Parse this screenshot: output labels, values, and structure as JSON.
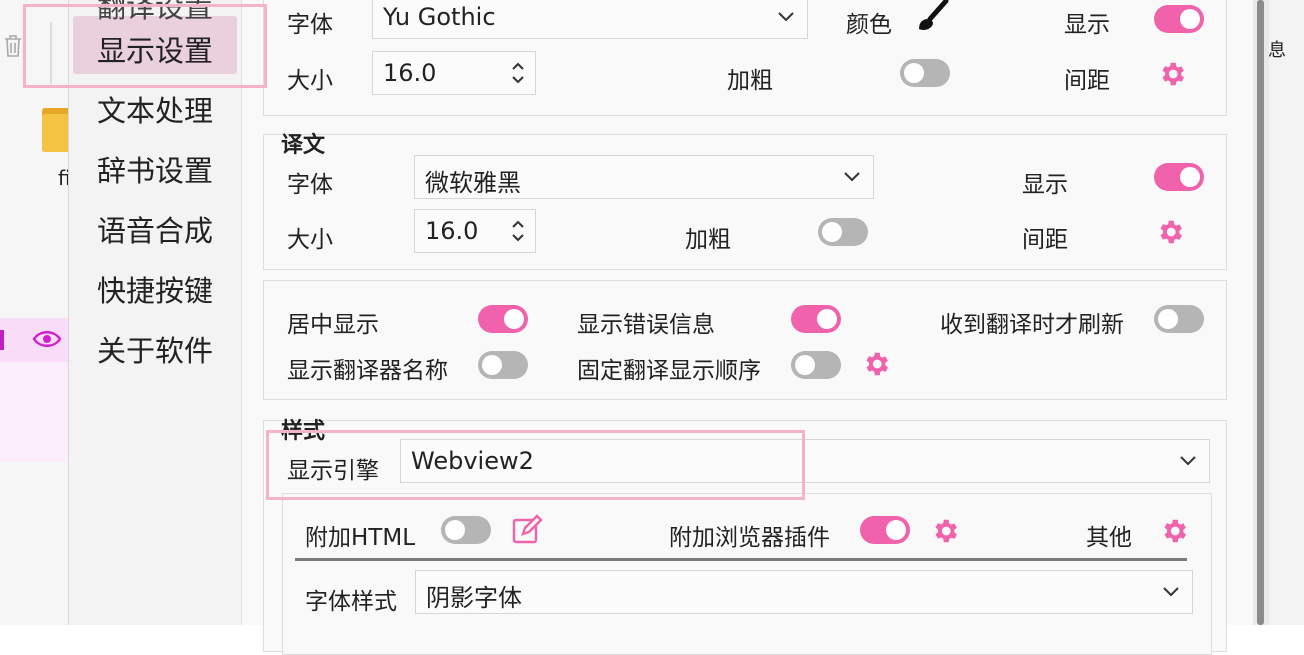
{
  "background_app": {
    "partial_label_right": "息",
    "partial_label_left": "fi"
  },
  "sidebar": {
    "items": [
      {
        "label": "显示设置",
        "selected": true
      },
      {
        "label": "文本处理"
      },
      {
        "label": "辞书设置"
      },
      {
        "label": "语音合成"
      },
      {
        "label": "快捷按键"
      },
      {
        "label": "关于软件"
      }
    ]
  },
  "original_text": {
    "font_label": "字体",
    "font_value": "Yu Gothic",
    "color_label": "颜色",
    "show_label": "显示",
    "show_on": true,
    "size_label": "大小",
    "size_value": "16.0",
    "bold_label": "加粗",
    "bold_on": false,
    "spacing_label": "间距"
  },
  "translation": {
    "title": "译文",
    "font_label": "字体",
    "font_value": "微软雅黑",
    "show_label": "显示",
    "show_on": true,
    "size_label": "大小",
    "size_value": "16.0",
    "bold_label": "加粗",
    "bold_on": false,
    "spacing_label": "间距"
  },
  "options": {
    "center_label": "居中显示",
    "center_on": true,
    "show_error_label": "显示错误信息",
    "show_error_on": true,
    "refresh_label": "收到翻译时才刷新",
    "refresh_on": false,
    "show_name_label": "显示翻译器名称",
    "show_name_on": false,
    "fixed_order_label": "固定翻译显示顺序",
    "fixed_order_on": false
  },
  "style": {
    "title": "样式",
    "engine_label": "显示引擎",
    "engine_value": "Webview2",
    "extra_html_label": "附加HTML",
    "extra_html_on": false,
    "browser_plugin_label": "附加浏览器插件",
    "browser_plugin_on": true,
    "other_label": "其他",
    "font_style_label": "字体样式",
    "font_style_value": "阴影字体"
  },
  "colors": {
    "accent": "#f062ac",
    "highlight_border": "#f4b3cb",
    "selected_bg": "#ead0dc"
  }
}
